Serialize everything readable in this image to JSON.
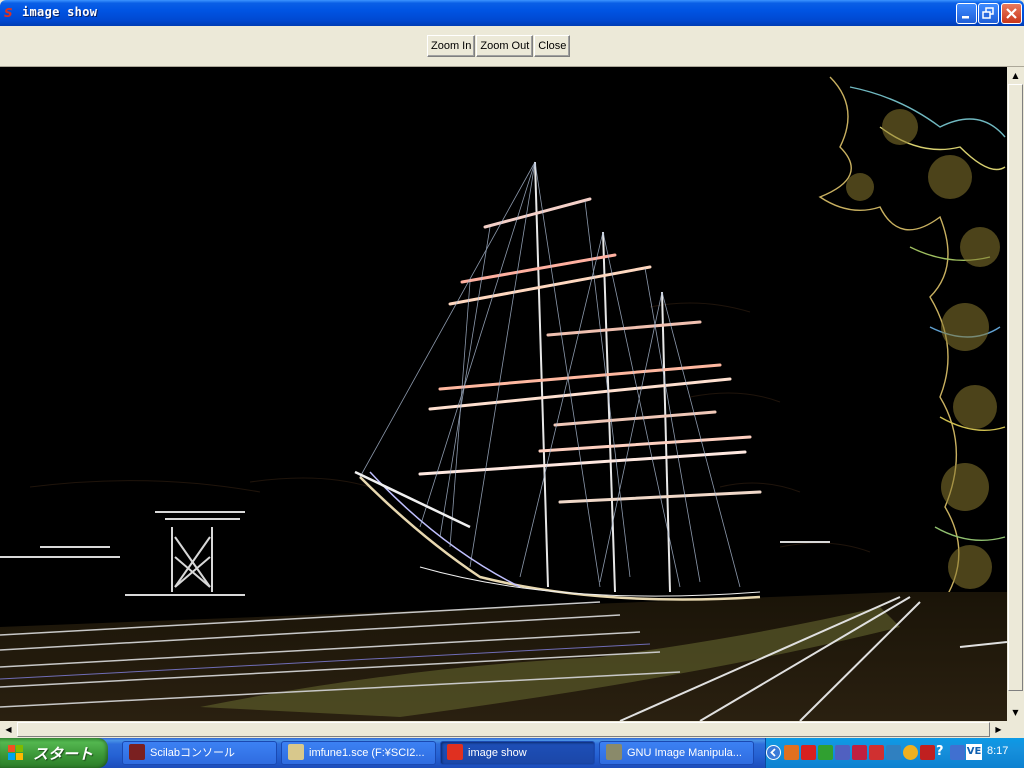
{
  "window": {
    "title": "image show",
    "app_icon_glyph": "S",
    "controls": [
      "minimize-icon",
      "restore-icon",
      "close-icon"
    ]
  },
  "toolbar": {
    "zoom_in_label": "Zoom In",
    "zoom_out_label": "Zoom Out",
    "close_label": "Close"
  },
  "image": {
    "description_icon": "edge-filtered-sailing-ship-image"
  },
  "scrollbars": {
    "up_arrow": "▲",
    "down_arrow": "▼",
    "left_arrow": "◀",
    "right_arrow": "▶"
  },
  "taskbar": {
    "start_label": "スタート",
    "tasks": [
      {
        "label": "Scilabコンソール",
        "icon": "scilab-icon",
        "color": "#7a2020"
      },
      {
        "label": "imfune1.sce (F:¥SCI2...",
        "icon": "notepad-icon",
        "color": "#d8c88c"
      },
      {
        "label": "image show",
        "icon": "scilab-window-icon",
        "color": "#e03020"
      },
      {
        "label": "GNU Image Manipula...",
        "icon": "gimp-icon",
        "color": "#8a8a6a"
      }
    ],
    "tray_icons": [
      "chevron-left-icon",
      "tray-app-icon",
      "tray-app-icon",
      "tray-app-icon",
      "tray-app-icon",
      "tray-app-icon",
      "tray-app-icon",
      "tray-app-icon",
      "tray-app-icon",
      "tray-app-icon",
      "tray-app-icon",
      "tray-app-icon",
      "tray-app-icon"
    ],
    "tray_misc": "?",
    "tray_ime": "VE",
    "clock": "8:17"
  },
  "colors": {
    "title_blue": "#0054e3",
    "taskbar_blue": "#2561d3",
    "start_green": "#3a9536",
    "tray_blue": "#1690dc",
    "dialog_gray": "#ece9d8"
  }
}
